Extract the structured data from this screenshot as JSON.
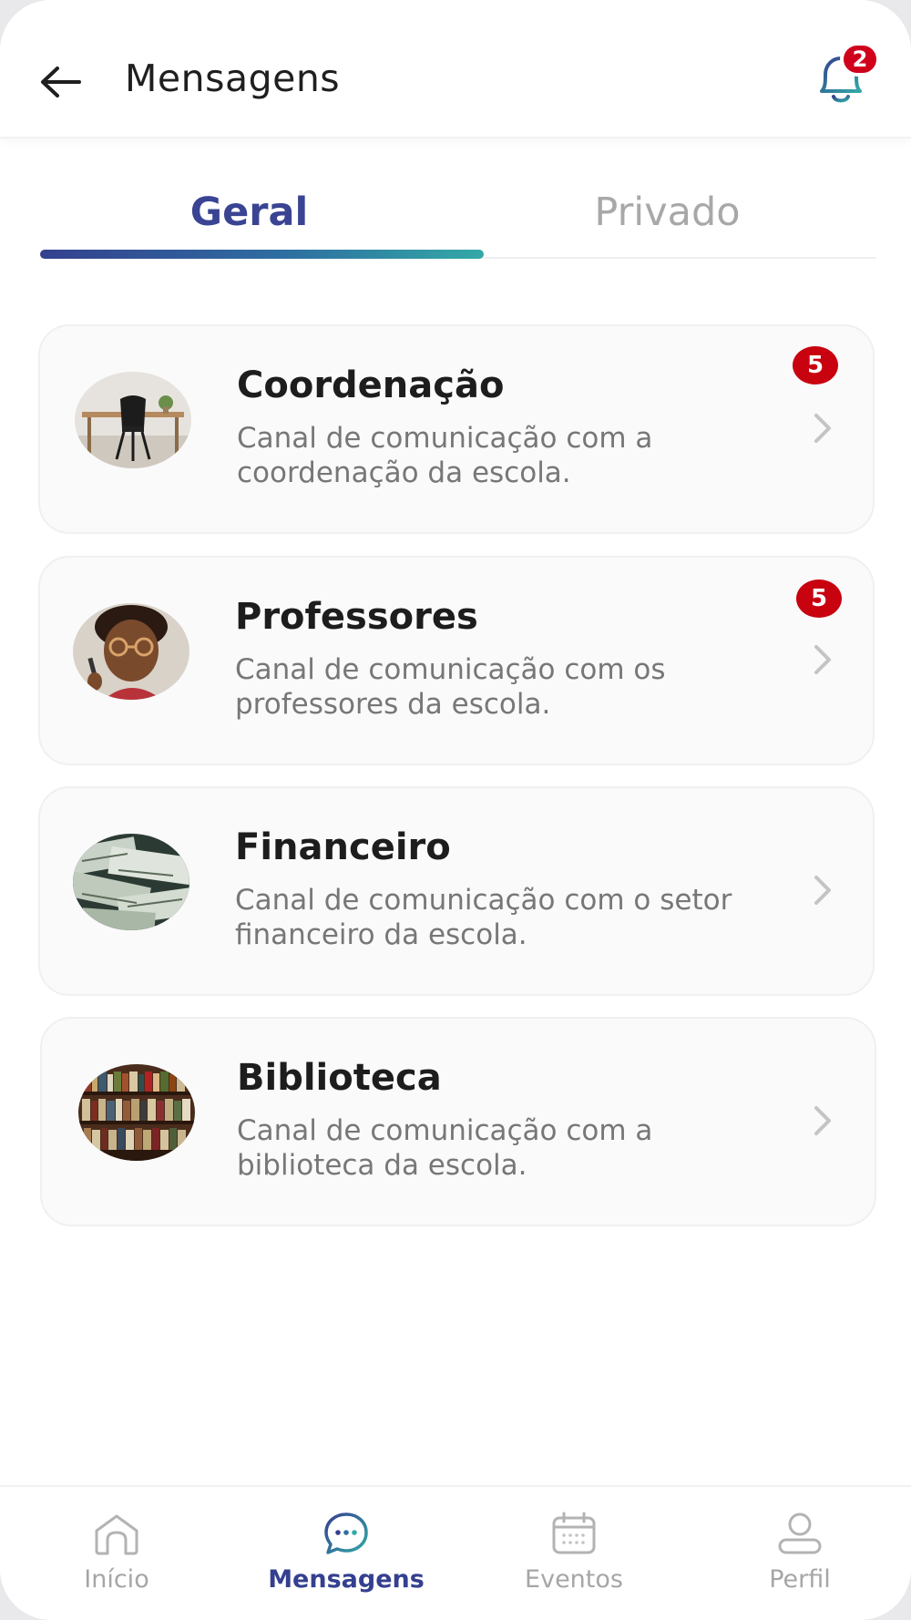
{
  "header": {
    "title": "Mensagens",
    "notification_count": "2"
  },
  "tabs": [
    {
      "label": "Geral",
      "active": true
    },
    {
      "label": "Privado",
      "active": false
    }
  ],
  "channels": [
    {
      "title": "Coordenação",
      "description": "Canal de comunicação com a coordenação da escola.",
      "badge": "5",
      "avatar_icon": "desk-chair-photo"
    },
    {
      "title": "Professores",
      "description": "Canal de comunicação com os professores da escola.",
      "badge": "5",
      "avatar_icon": "teacher-photo"
    },
    {
      "title": "Financeiro",
      "description": "Canal de comunicação com o setor financeiro da escola.",
      "badge": null,
      "avatar_icon": "money-photo"
    },
    {
      "title": "Biblioteca",
      "description": "Canal de comunicação com a biblioteca da escola.",
      "badge": null,
      "avatar_icon": "bookshelf-photo"
    }
  ],
  "nav": [
    {
      "label": "Início",
      "icon": "home-icon",
      "active": false
    },
    {
      "label": "Mensagens",
      "icon": "chat-icon",
      "active": true
    },
    {
      "label": "Eventos",
      "icon": "calendar-icon",
      "active": false
    },
    {
      "label": "Perfil",
      "icon": "user-icon",
      "active": false
    }
  ],
  "colors": {
    "primary": "#34408f",
    "accent": "#33a9a6",
    "badge": "#c8020f",
    "text_muted": "#a6a6a6"
  }
}
